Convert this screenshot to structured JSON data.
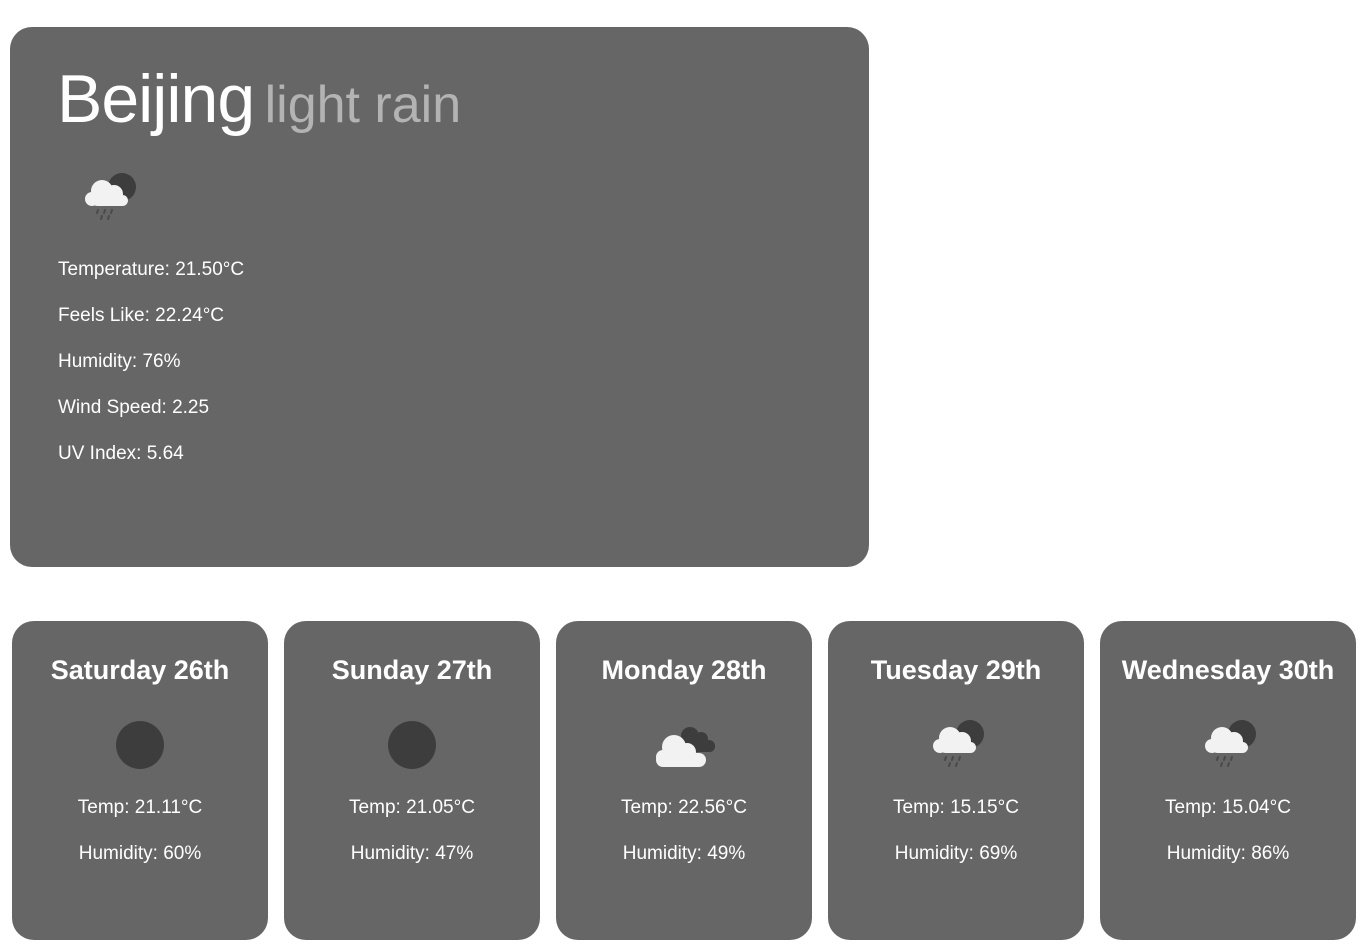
{
  "current": {
    "city": "Beijing",
    "condition": "light rain",
    "icon": "rain-cloud-night-icon",
    "stats": [
      {
        "label": "Temperature:",
        "value": "21.50°C"
      },
      {
        "label": "Feels Like:",
        "value": "22.24°C"
      },
      {
        "label": "Humidity:",
        "value": "76%"
      },
      {
        "label": "Wind Speed:",
        "value": "2.25"
      },
      {
        "label": "UV Index:",
        "value": "5.64"
      }
    ]
  },
  "forecast": [
    {
      "day": "Saturday 26th",
      "icon": "clear-night-icon",
      "temp_label": "Temp:",
      "temp": "21.11°C",
      "hum_label": "Humidity:",
      "humidity": "60%"
    },
    {
      "day": "Sunday 27th",
      "icon": "clear-night-icon",
      "temp_label": "Temp:",
      "temp": "21.05°C",
      "hum_label": "Humidity:",
      "humidity": "47%"
    },
    {
      "day": "Monday 28th",
      "icon": "clouds-icon",
      "temp_label": "Temp:",
      "temp": "22.56°C",
      "hum_label": "Humidity:",
      "humidity": "49%"
    },
    {
      "day": "Tuesday 29th",
      "icon": "rain-cloud-night-icon",
      "temp_label": "Temp:",
      "temp": "15.15°C",
      "hum_label": "Humidity:",
      "humidity": "69%"
    },
    {
      "day": "Wednesday 30th",
      "icon": "rain-cloud-night-icon",
      "temp_label": "Temp:",
      "temp": "15.04°C",
      "hum_label": "Humidity:",
      "humidity": "86%"
    }
  ],
  "colors": {
    "card": "#666666",
    "text": "#ffffff",
    "condition": "#b3b3b3",
    "moon": "#3d3d3d",
    "cloud": "#f2f2f2"
  }
}
